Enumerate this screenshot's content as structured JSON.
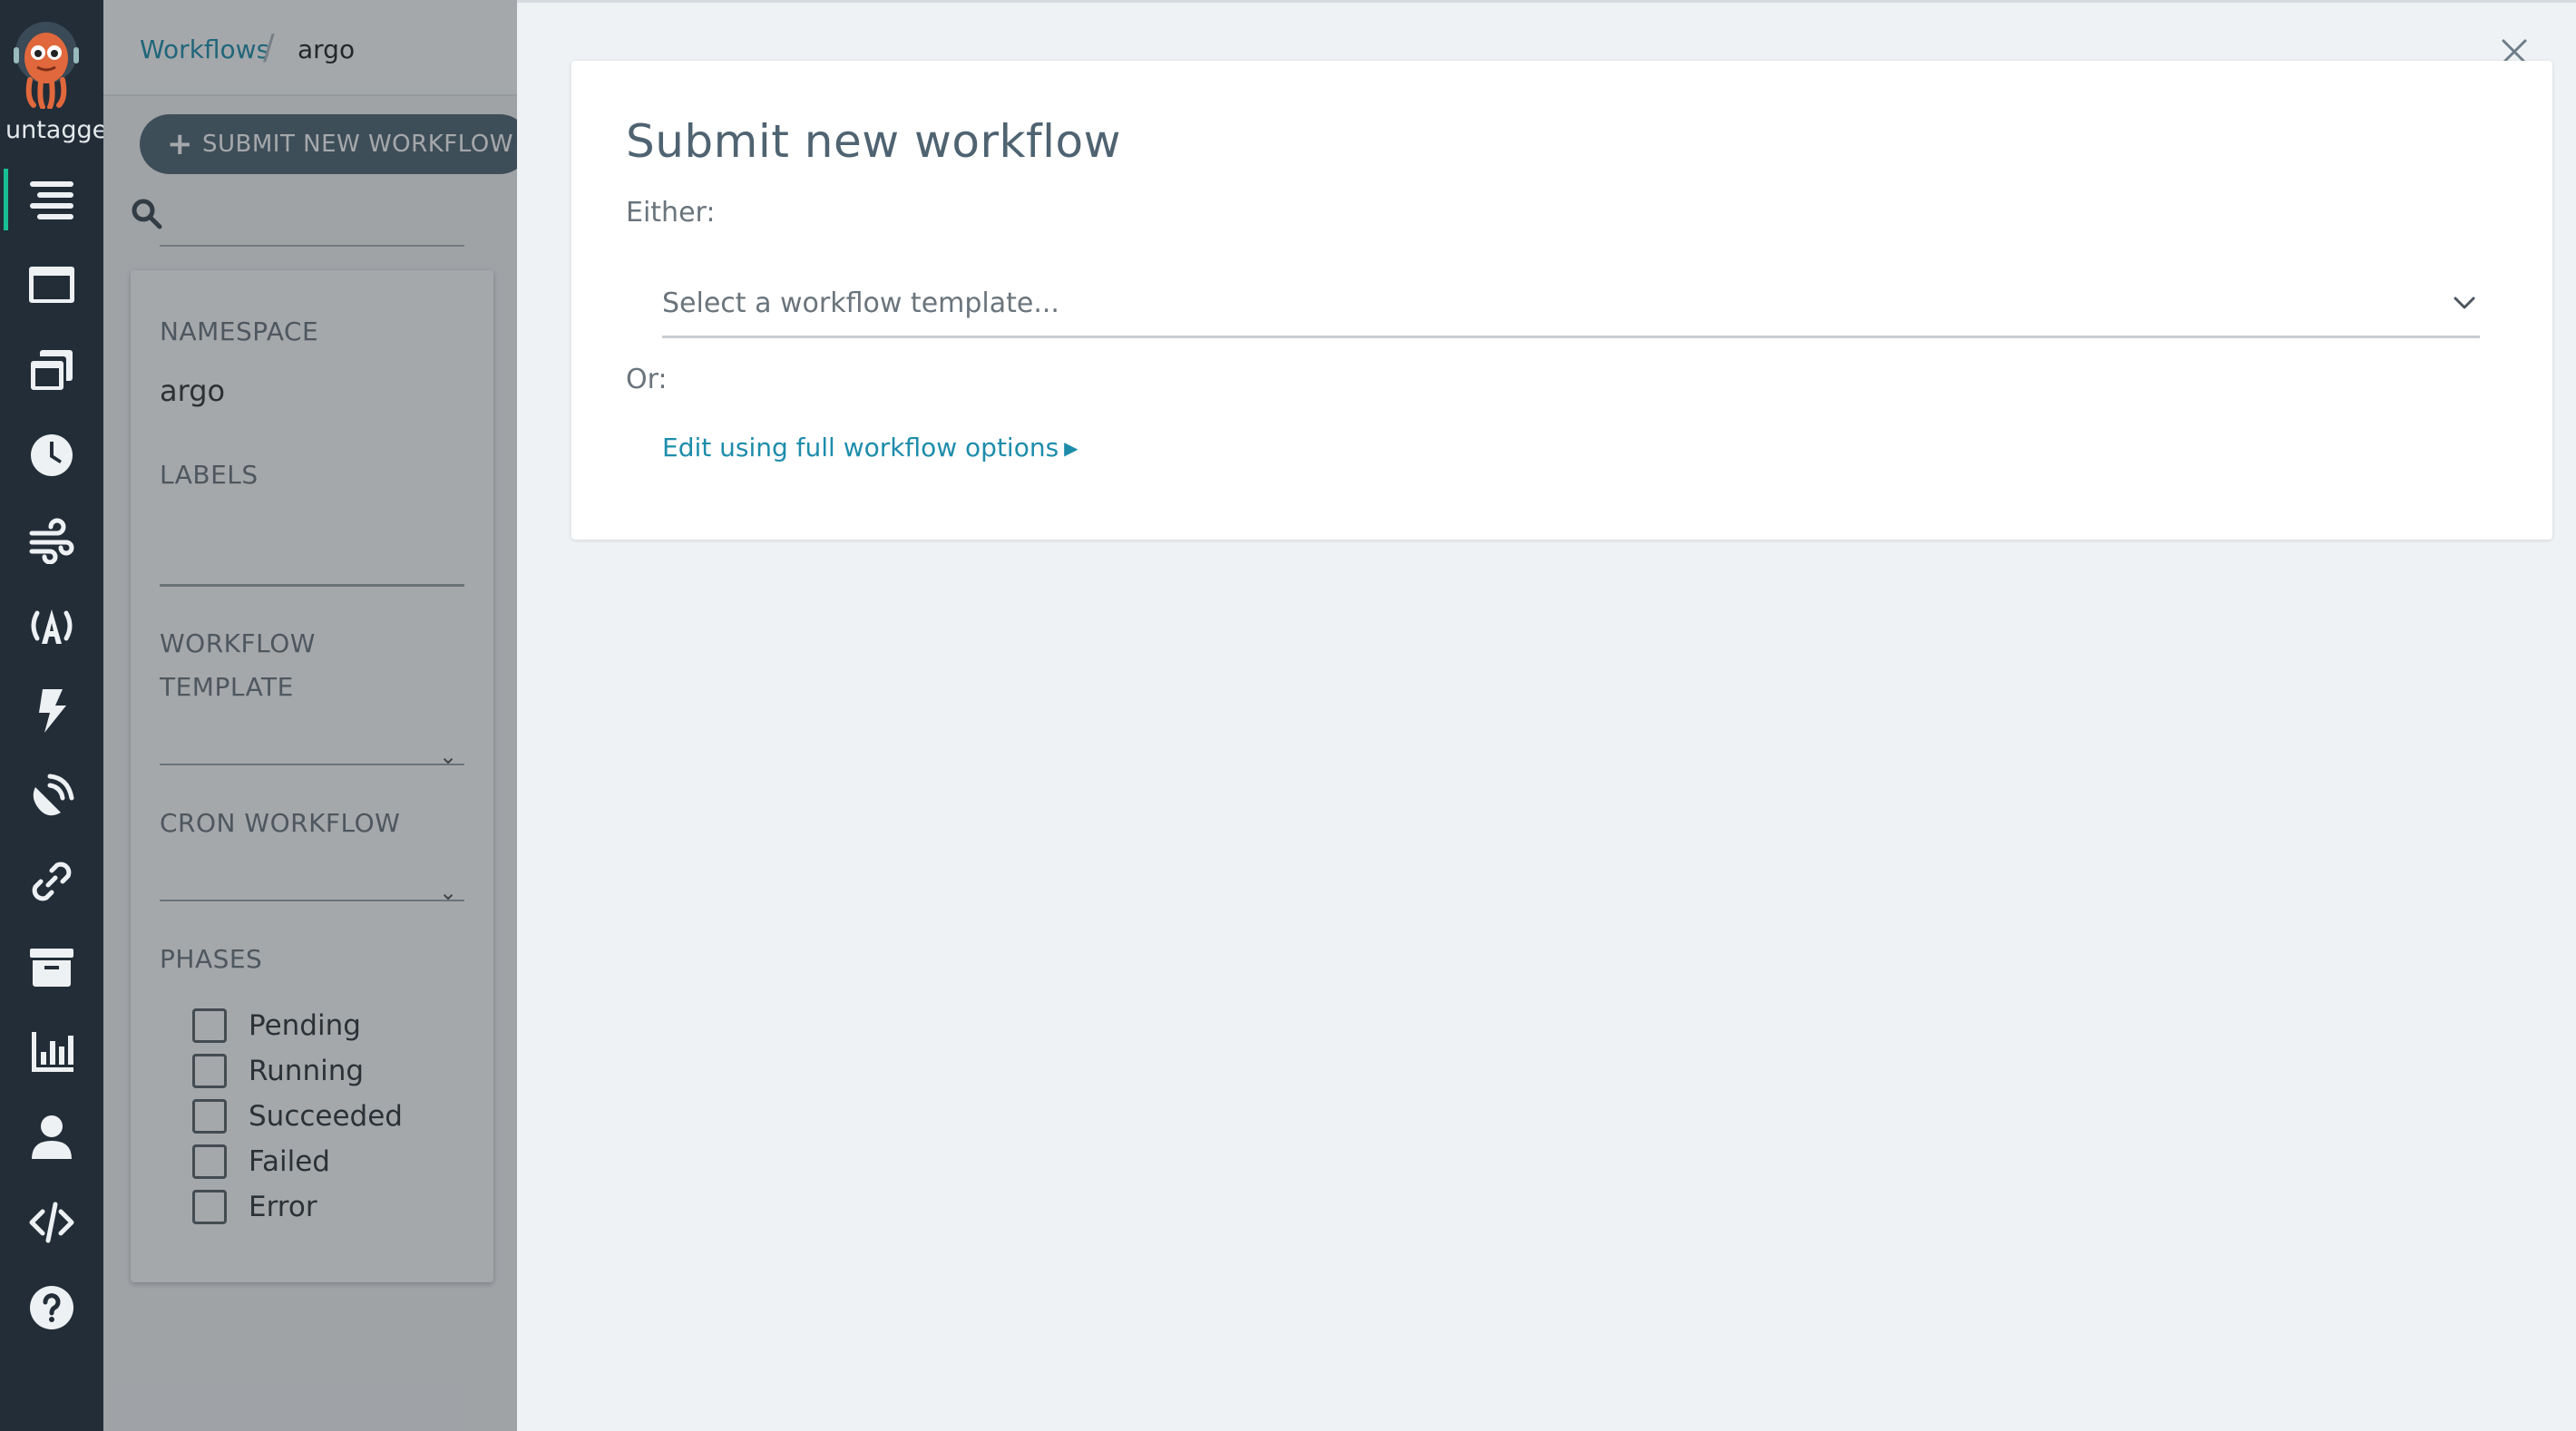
{
  "app": {
    "version_label": "untagged",
    "logo_icon": "argo-octopus-logo"
  },
  "nav": {
    "items": [
      {
        "icon": "list-icon",
        "active": true
      },
      {
        "icon": "window-icon",
        "active": false
      },
      {
        "icon": "copy-icon",
        "active": false
      },
      {
        "icon": "clock-icon",
        "active": false
      },
      {
        "icon": "wind-icon",
        "active": false
      },
      {
        "icon": "broadcast-icon",
        "active": false
      },
      {
        "icon": "bolt-icon",
        "active": false
      },
      {
        "icon": "satellite-dish-icon",
        "active": false
      },
      {
        "icon": "link-icon",
        "active": false
      },
      {
        "icon": "archive-icon",
        "active": false
      },
      {
        "icon": "chart-bar-icon",
        "active": false
      },
      {
        "icon": "user-icon",
        "active": false
      },
      {
        "icon": "code-icon",
        "active": false
      },
      {
        "icon": "help-icon",
        "active": false
      }
    ]
  },
  "breadcrumb": {
    "parent": "Workflows",
    "separator": "/",
    "current": "argo"
  },
  "toolbar": {
    "submit_label": "SUBMIT NEW WORKFLOW"
  },
  "filters": {
    "namespace_label": "NAMESPACE",
    "namespace_value": "argo",
    "labels_label": "LABELS",
    "workflow_template_label_line1": "WORKFLOW",
    "workflow_template_label_line2": "TEMPLATE",
    "cron_workflow_label": "CRON WORKFLOW",
    "phases_label": "PHASES",
    "phases": [
      "Pending",
      "Running",
      "Succeeded",
      "Failed",
      "Error"
    ]
  },
  "submit_panel": {
    "title": "Submit new workflow",
    "either_label": "Either:",
    "template_placeholder": "Select a workflow template...",
    "or_label": "Or:",
    "edit_link": "Edit using full workflow options"
  },
  "colors": {
    "rail_bg": "#222d38",
    "accent_teal": "#18be94",
    "link": "#1d8dab",
    "button_bg": "#4e6473"
  }
}
